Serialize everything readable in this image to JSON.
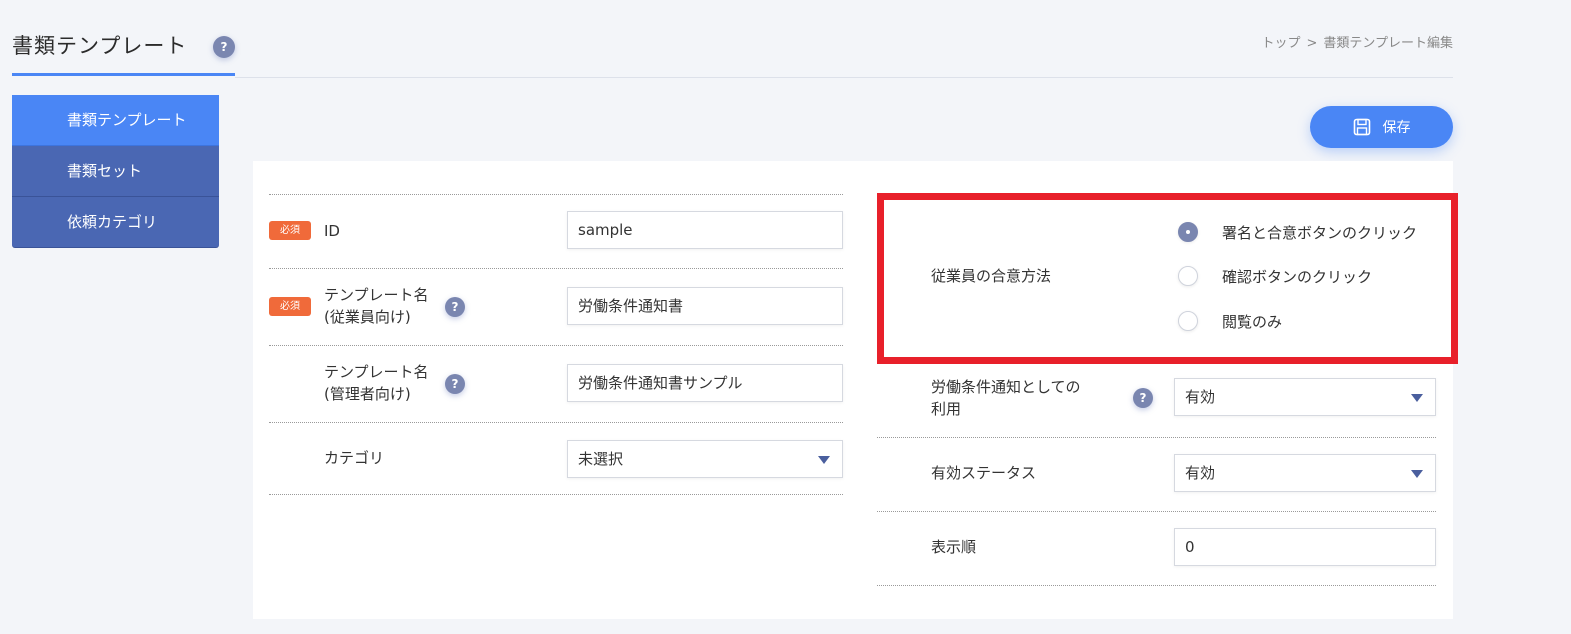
{
  "header": {
    "title": "書類テンプレート",
    "help": "?",
    "breadcrumb": {
      "top": "トップ",
      "separator": ">",
      "current": "書類テンプレート編集"
    }
  },
  "sidebar": {
    "items": [
      {
        "label": "書類テンプレート",
        "active": true
      },
      {
        "label": "書類セット",
        "active": false
      },
      {
        "label": "依頼カテゴリ",
        "active": false
      }
    ]
  },
  "toolbar": {
    "save_label": "保存"
  },
  "form_left": {
    "required_badge": "必須",
    "help": "?",
    "id_label": "ID",
    "id_value": "sample",
    "template_name_employee_line1": "テンプレート名",
    "template_name_employee_line2": "(従業員向け)",
    "template_name_employee_value": "労働条件通知書",
    "template_name_admin_line1": "テンプレート名",
    "template_name_admin_line2": "(管理者向け)",
    "template_name_admin_value": "労働条件通知書サンプル",
    "category_label": "カテゴリ",
    "category_value": "未選択"
  },
  "form_right": {
    "consent_label": "従業員の合意方法",
    "consent_options": [
      {
        "label": "署名と合意ボタンのクリック",
        "checked": true
      },
      {
        "label": "確認ボタンのクリック",
        "checked": false
      },
      {
        "label": "閲覧のみ",
        "checked": false
      }
    ],
    "labor_notice_line1": "労働条件通知としての",
    "labor_notice_line2": "利用",
    "labor_notice_value": "有効",
    "status_label": "有効ステータス",
    "status_value": "有効",
    "order_label": "表示順",
    "order_value": "0"
  },
  "colors": {
    "accent": "#4a86f5",
    "sidebar": "#4a67b3",
    "required": "#f06a3a",
    "highlight_border": "#e8202a",
    "help_icon": "#7a86b0"
  },
  "icons": {
    "save": "floppy-disk-icon",
    "help": "question-mark-icon",
    "dropdown": "caret-down-icon"
  }
}
